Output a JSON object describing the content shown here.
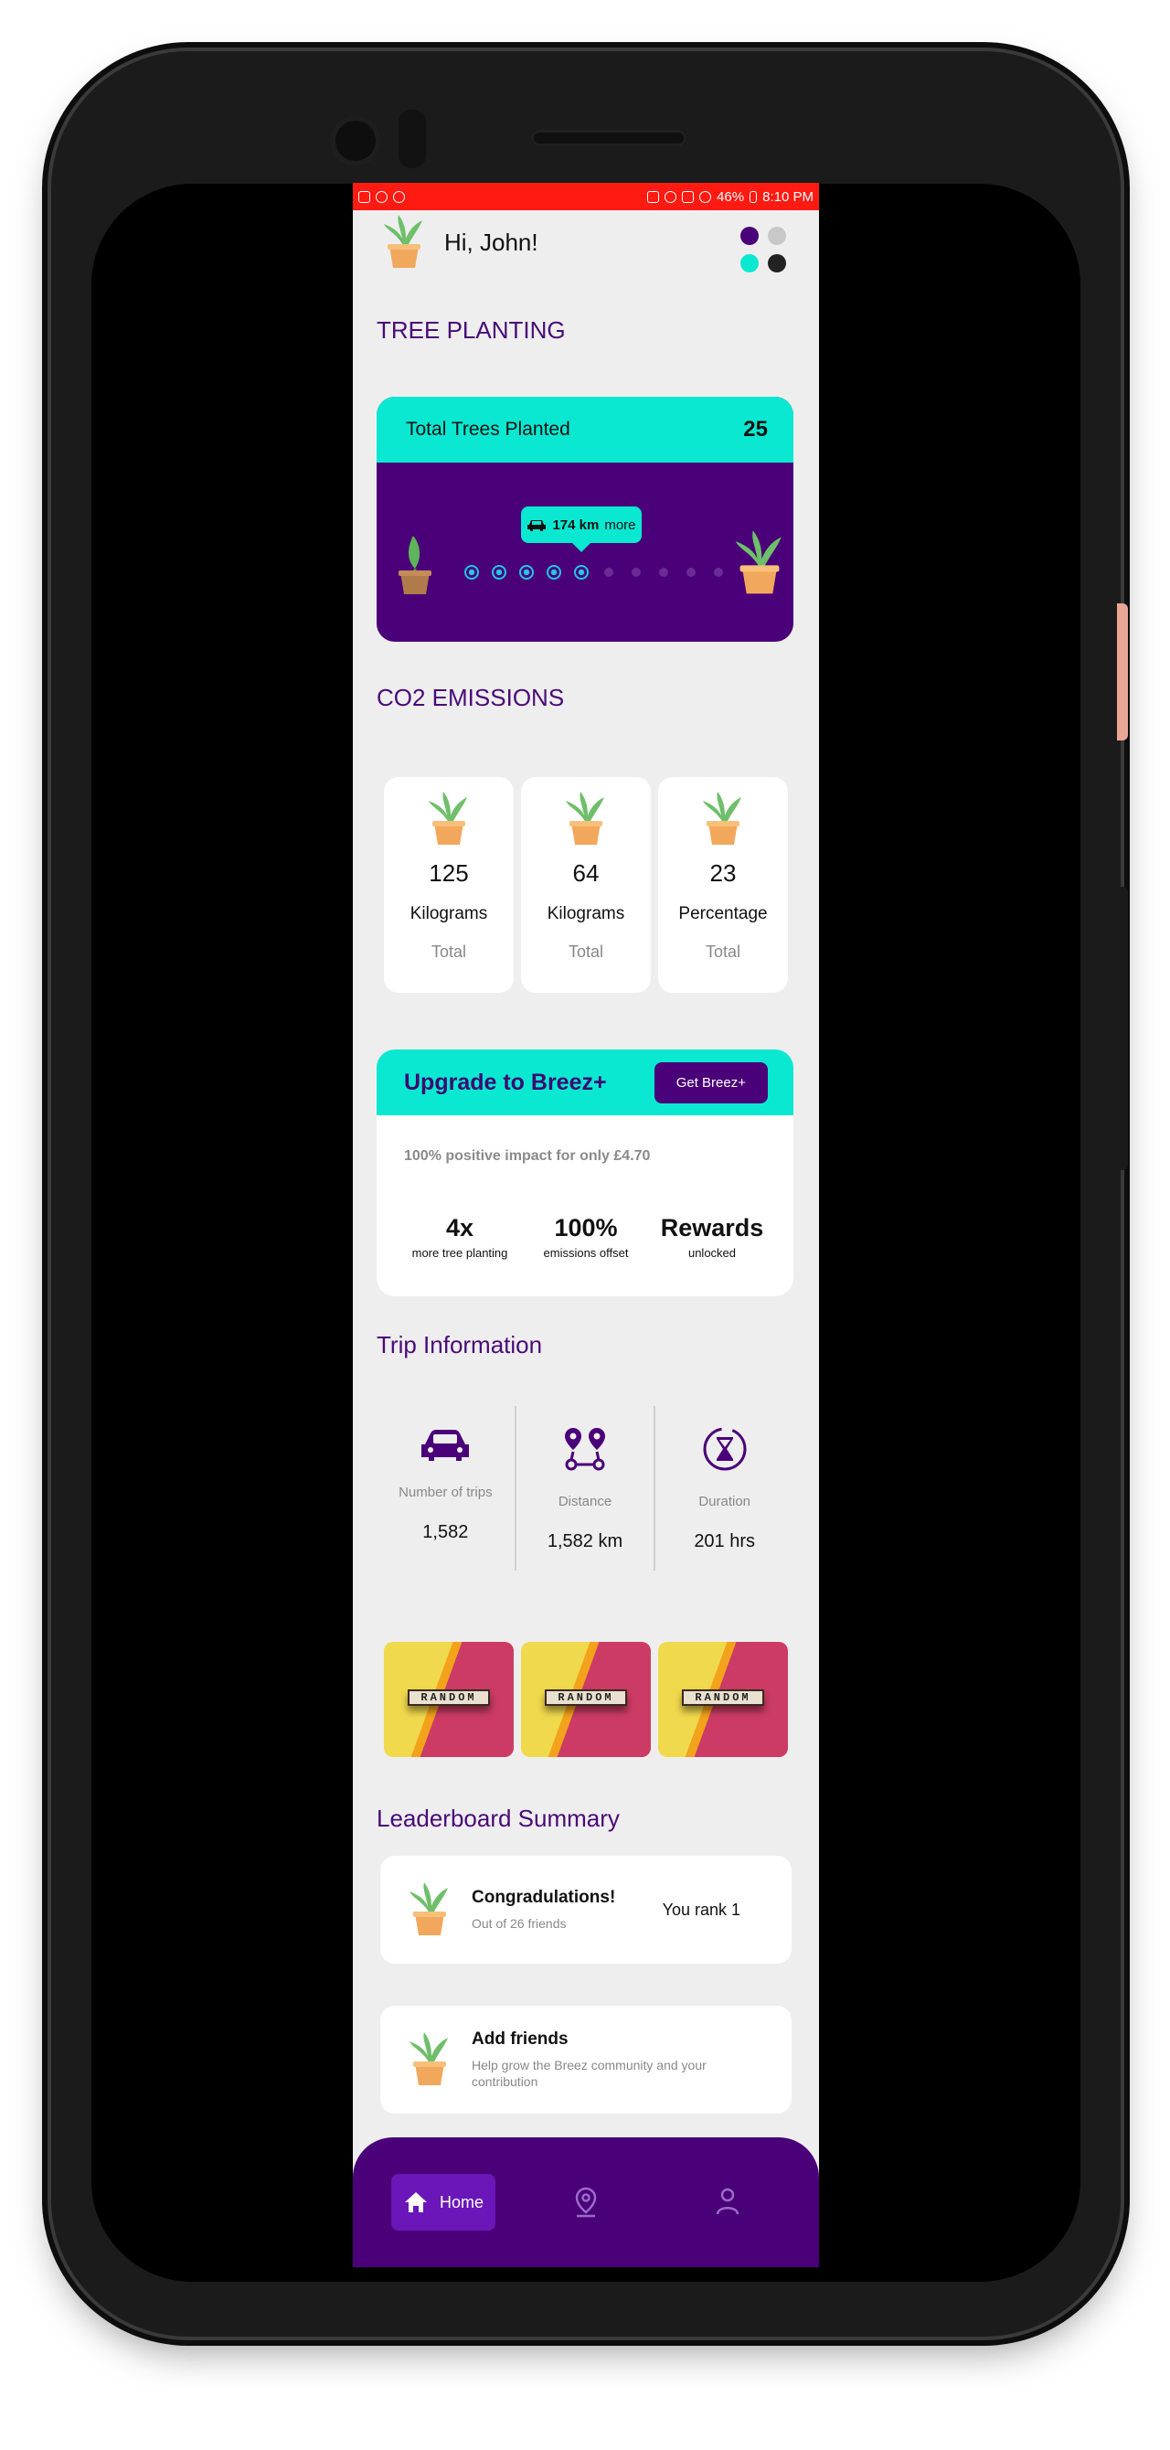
{
  "header": {
    "greeting": "Hi, John!"
  },
  "dots_colors": [
    "#4a0078",
    "#c8c8c8",
    "#0ae8d2",
    "#222222"
  ],
  "tree_planting": {
    "section_title": "TREE PLANTING",
    "card_label": "Total Trees Planted",
    "card_value": "25",
    "bubble_distance": "174 km",
    "bubble_suffix": "more",
    "progress": {
      "completed": 5,
      "total": 10
    }
  },
  "co2": {
    "section_title": "CO2 EMISSIONS",
    "cards": [
      {
        "value": "125",
        "unit": "Kilograms",
        "sub": "Total"
      },
      {
        "value": "64",
        "unit": "Kilograms",
        "sub": "Total"
      },
      {
        "value": "23",
        "unit": "Percentage",
        "sub": "Total"
      }
    ]
  },
  "upgrade": {
    "title": "Upgrade to Breez+",
    "button": "Get Breez+",
    "description": "100% positive impact for only £4.70",
    "stats": [
      {
        "big": "4x",
        "small": "more tree planting"
      },
      {
        "big": "100%",
        "small": "emissions offset"
      },
      {
        "big": "Rewards",
        "small": "unlocked"
      }
    ]
  },
  "trip": {
    "section_title": "Trip Information",
    "items": [
      {
        "label": "Number of trips",
        "value": "1,582",
        "icon": "car-icon"
      },
      {
        "label": "Distance",
        "value": "1,582 km",
        "icon": "route-pins-icon"
      },
      {
        "label": "Duration",
        "value": "201 hrs",
        "icon": "hourglass-icon"
      }
    ]
  },
  "tiles": [
    "RANDOM",
    "RANDOM",
    "RANDOM"
  ],
  "leaderboard": {
    "section_title": "Leaderboard Summary",
    "congrats_title": "Congradulations!",
    "congrats_sub": "Out of 26 friends",
    "rank": "You rank 1",
    "add_title": "Add friends",
    "add_sub": "Help grow the Breez community and your contribution"
  },
  "nav": {
    "home_label": "Home"
  },
  "status": {
    "battery": "46%",
    "time": "8:10 PM"
  },
  "colors": {
    "accent": "#0ae8d2",
    "brand": "#4a0078",
    "statusbar": "#ff1a12"
  }
}
